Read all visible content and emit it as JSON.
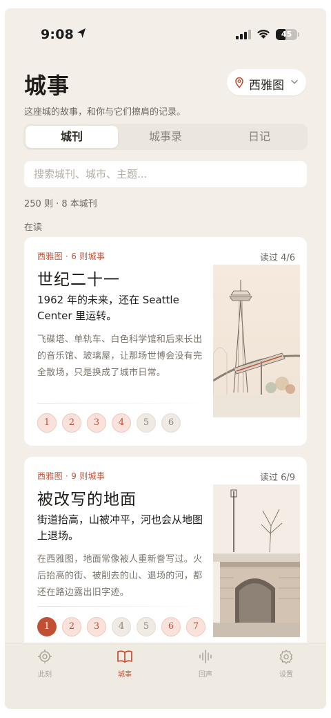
{
  "status_bar": {
    "time": "9:08",
    "battery": "45"
  },
  "header": {
    "title": "城事",
    "city": "西雅图",
    "subtitle": "这座城的故事，和你与它们擦肩的记录。"
  },
  "segments": [
    {
      "label": "城刊",
      "active": true
    },
    {
      "label": "城事录",
      "active": false
    },
    {
      "label": "日记",
      "active": false
    }
  ],
  "search": {
    "placeholder": "搜索城刊、城市、主题..."
  },
  "summary": "250 则 · 8 本城刊",
  "section_label": "在读",
  "cards": [
    {
      "meta": "西雅图 · 6 则城事",
      "progress": "读过 4/6",
      "title": "世纪二十一",
      "lead": "1962 年的未来，还在 Seattle Center 里运转。",
      "body": "飞碟塔、单轨车、白色科学馆和后来长出的音乐馆、玻璃屋，让那场世博会没有完全散场，只是换成了城市日常。",
      "chapters": [
        {
          "n": "1",
          "state": "read"
        },
        {
          "n": "2",
          "state": "read"
        },
        {
          "n": "3",
          "state": "read"
        },
        {
          "n": "4",
          "state": "read"
        },
        {
          "n": "5",
          "state": "unread"
        },
        {
          "n": "6",
          "state": "unread"
        }
      ]
    },
    {
      "meta": "西雅图 · 9 则城事",
      "progress": "读过 6/9",
      "title": "被改写的地面",
      "lead": "街道抬高，山被冲平，河也会从地图上退场。",
      "body": "在西雅图，地面常像被人重新誊写过。火后抬高的街、被削去的山、退场的河，都还在路边露出旧字迹。",
      "chapters": [
        {
          "n": "1",
          "state": "current"
        },
        {
          "n": "2",
          "state": "read"
        },
        {
          "n": "3",
          "state": "read"
        },
        {
          "n": "4",
          "state": "unread"
        },
        {
          "n": "5",
          "state": "unread"
        },
        {
          "n": "6",
          "state": "read"
        },
        {
          "n": "7",
          "state": "read"
        }
      ]
    }
  ],
  "tabbar": [
    {
      "label": "此刻",
      "icon": "target-icon",
      "active": false
    },
    {
      "label": "城事",
      "icon": "book-icon",
      "active": true
    },
    {
      "label": "回声",
      "icon": "waveform-icon",
      "active": false
    },
    {
      "label": "设置",
      "icon": "gear-icon",
      "active": false
    }
  ],
  "colors": {
    "accent": "#c14f31",
    "background": "#f3efe8",
    "card": "#ffffff"
  }
}
